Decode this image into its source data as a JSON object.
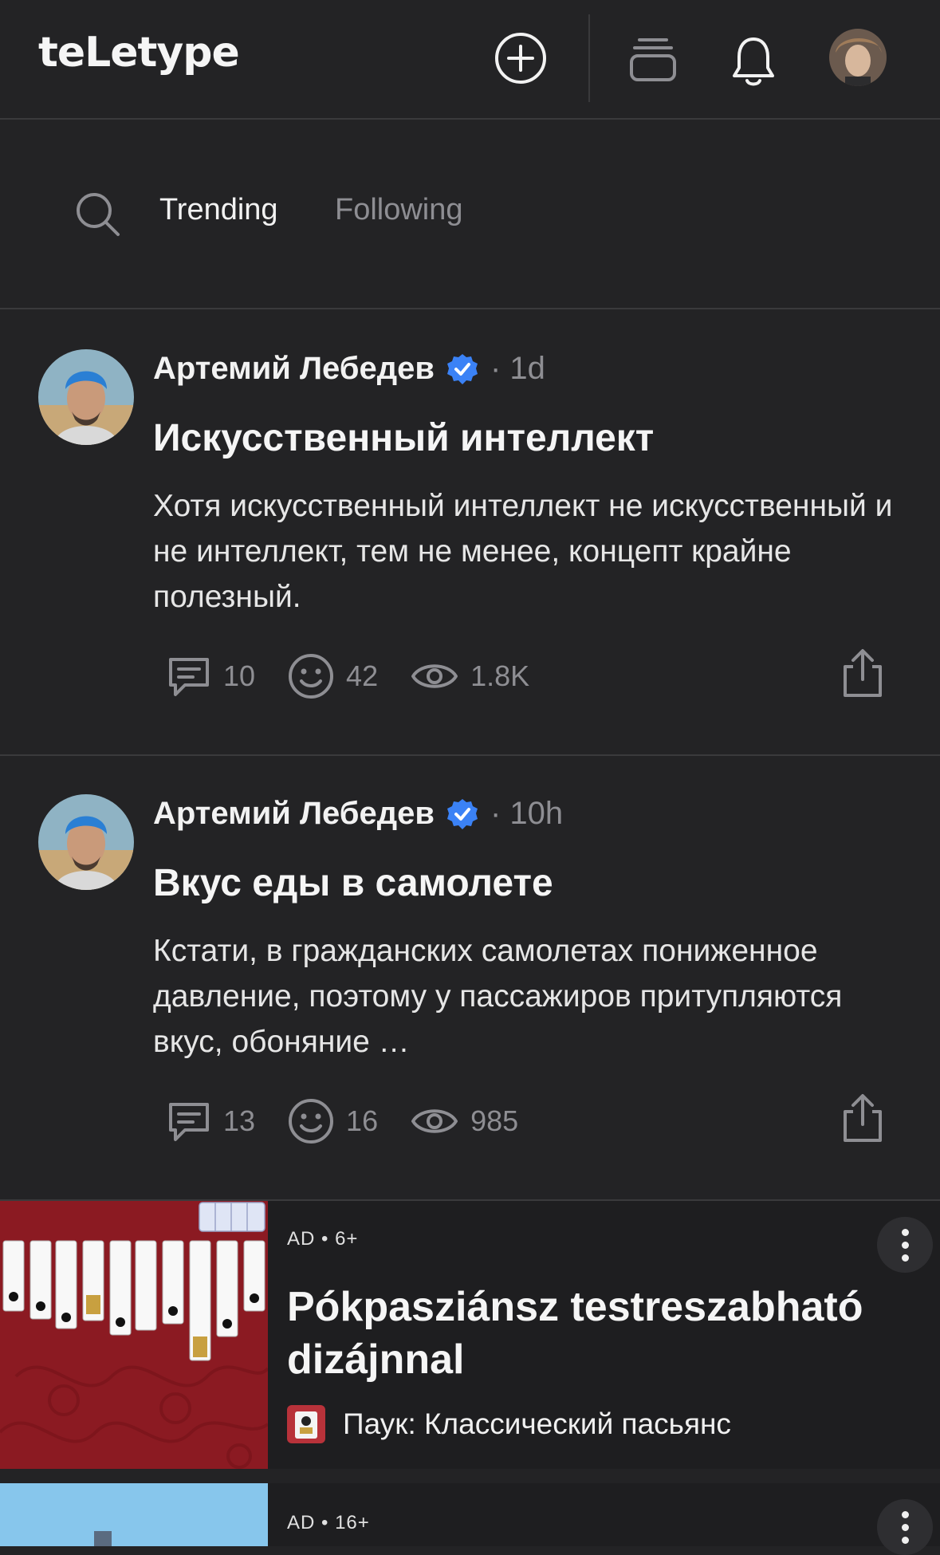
{
  "header": {
    "logo": "teLetype",
    "icons": [
      "plus-circle-icon",
      "stack-icon",
      "bell-icon",
      "avatar"
    ]
  },
  "tabs": {
    "search_icon": "search-icon",
    "items": [
      {
        "label": "Trending",
        "active": true
      },
      {
        "label": "Following",
        "active": false
      }
    ]
  },
  "posts": [
    {
      "author": "Артемий Лебедев",
      "verified": true,
      "time": "· 1d",
      "title": "Искусственный интеллект",
      "excerpt": "Хотя искусственный интеллект не искусственный и не интеллект, тем не менее, концепт крайне полезный.",
      "comments": "10",
      "reactions": "42",
      "views": "1.8K"
    },
    {
      "author": "Артемий Лебедев",
      "verified": true,
      "time": "· 10h",
      "title": "Вкус еды в самолете",
      "excerpt": "Кстати, в гражданских самолетах пониженное давление, поэтому у пассажиров притупляются вкус, обоняние …",
      "comments": "13",
      "reactions": "16",
      "views": "985"
    }
  ],
  "ads": [
    {
      "meta": "AD • 6+",
      "title": "Pókpasziánsz testreszabható dizájnnal",
      "source": "Паук: Классический пасьянс"
    },
    {
      "meta": "AD • 16+"
    }
  ],
  "colors": {
    "background": "#232325",
    "accent_verified": "#3b82f6",
    "muted": "#8e8e93",
    "ad_image_bg": "#8b1a22"
  }
}
